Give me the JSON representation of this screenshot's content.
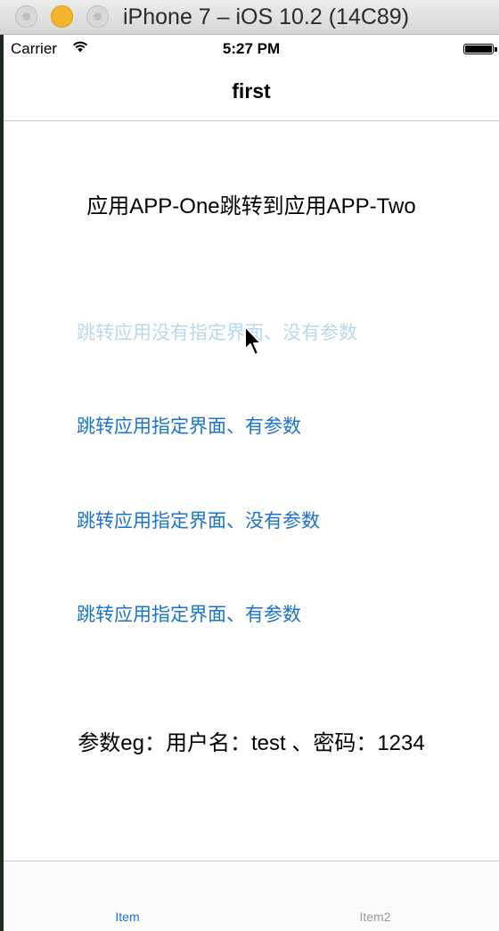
{
  "window": {
    "title": "iPhone 7 – iOS 10.2 (14C89)"
  },
  "status_bar": {
    "carrier": "Carrier",
    "time": "5:27 PM"
  },
  "nav": {
    "title": "first"
  },
  "main": {
    "heading": "应用APP-One跳转到应用APP-Two",
    "links": [
      "跳转应用没有指定界面、没有参数",
      "跳转应用指定界面、有参数",
      "跳转应用指定界面、没有参数",
      "跳转应用指定界面、有参数"
    ],
    "params_text": "参数eg：用户名：test 、密码：1234"
  },
  "tab_bar": {
    "items": [
      "Item",
      "Item2"
    ],
    "selected": 0
  },
  "colors": {
    "link": "#1a73cc",
    "link_pressed": "#b9d7ee",
    "tab_inactive": "#999999"
  }
}
